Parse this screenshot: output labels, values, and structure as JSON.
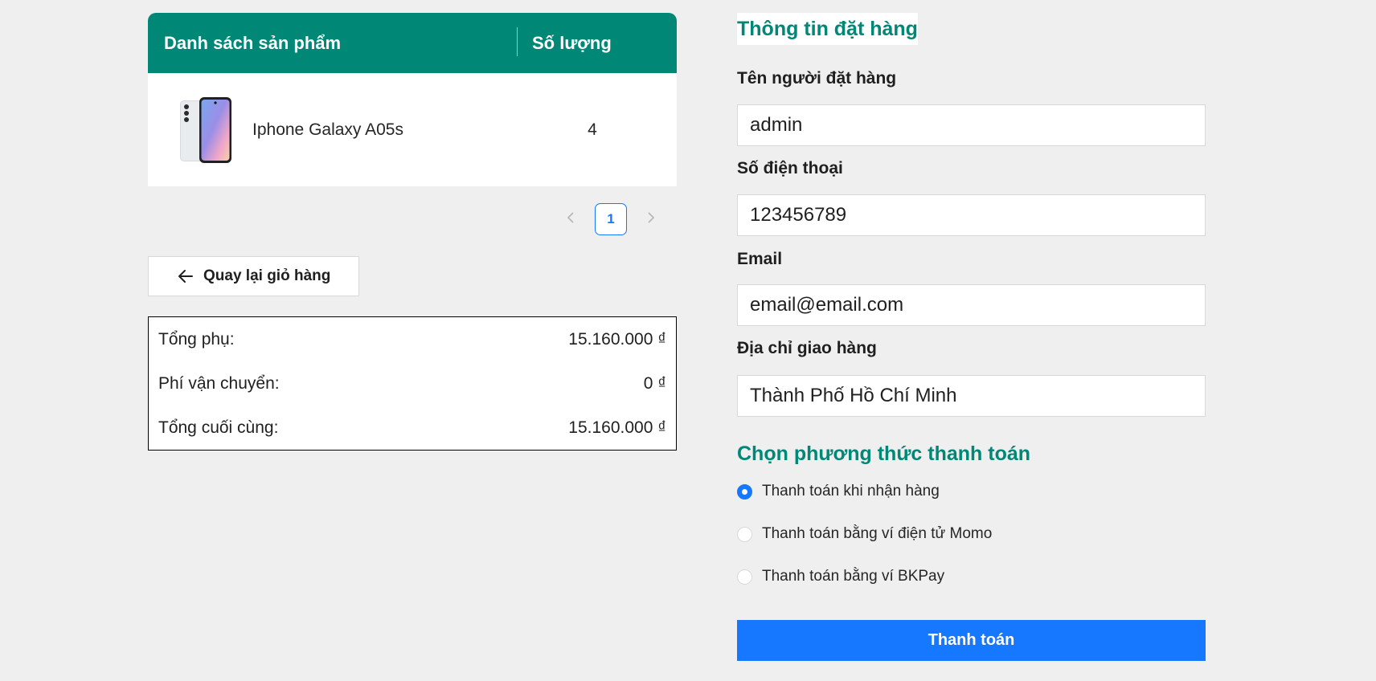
{
  "cart": {
    "header": {
      "name_col": "Danh sách sản phẩm",
      "qty_col": "Số lượng"
    },
    "items": [
      {
        "name": "Iphone Galaxy A05s",
        "qty": "4",
        "image_icon": "phone-image"
      }
    ],
    "pagination": {
      "current": "1",
      "prev_icon": "chevron-left-icon",
      "next_icon": "chevron-right-icon"
    }
  },
  "back_button": {
    "label": "Quay lại giỏ hàng",
    "icon": "arrow-left-icon"
  },
  "summary": {
    "subtotal_label": "Tổng phụ:",
    "subtotal_value": "15.160.000 ₫",
    "shipping_label": "Phí vận chuyển:",
    "shipping_value": "0 ₫",
    "total_label": "Tổng cuối cùng:",
    "total_value": "15.160.000 ₫"
  },
  "order_form": {
    "title": "Thông tin đặt hàng",
    "name_label": "Tên người đặt hàng",
    "name_value": "admin",
    "phone_label": "Số điện thoại",
    "phone_value": "123456789",
    "email_label": "Email",
    "email_value": "email@email.com",
    "address_label": "Địa chỉ giao hàng",
    "address_value": "Thành Phố Hồ Chí Minh"
  },
  "payment": {
    "title": "Chọn phương thức thanh toán",
    "options": [
      {
        "label": "Thanh toán khi nhận hàng",
        "selected": true
      },
      {
        "label": "Thanh toán bằng ví điện tử Momo",
        "selected": false
      },
      {
        "label": "Thanh toán bằng ví BKPay",
        "selected": false
      }
    ],
    "submit_label": "Thanh toán"
  },
  "colors": {
    "primary": "#008775",
    "accent": "#1677ff",
    "background": "#efefef"
  }
}
